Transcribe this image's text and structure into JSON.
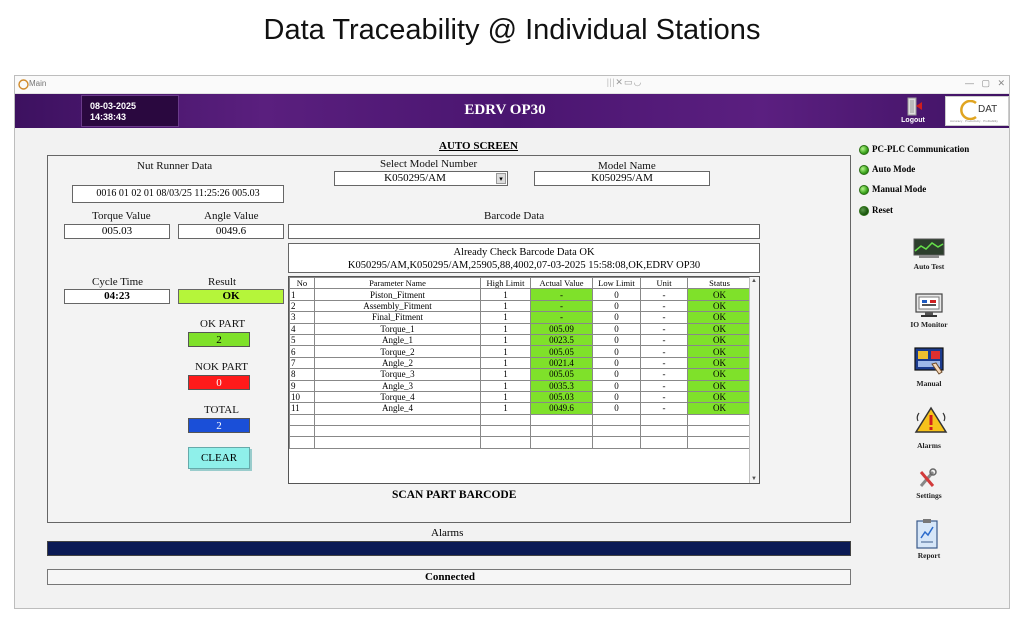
{
  "slide_title": "Data Traceability @ Individual Stations",
  "window": {
    "caption": "Main"
  },
  "header": {
    "date": "08-03-2025",
    "time": "14:38:43",
    "station_title": "EDRV OP30",
    "logout_label": "Logout",
    "logo_text": "DAT",
    "logo_tagline": "Accuracy · Productivity · Profitability"
  },
  "screen_label": "AUTO SCREEN",
  "nut_runner": {
    "label": "Nut Runner Data",
    "value": "0016 01 02 01 08/03/25 11:25:26  005.03"
  },
  "model_select": {
    "label": "Select Model Number",
    "value": "K050295/AM"
  },
  "model_name": {
    "label": "Model Name",
    "value": "K050295/AM"
  },
  "torque": {
    "label": "Torque Value",
    "value": "005.03"
  },
  "angle": {
    "label": "Angle Value",
    "value": "0049.6"
  },
  "barcode": {
    "label": "Barcode Data",
    "value": "",
    "message_line1": "Already Check Barcode Data OK",
    "message_line2": "K050295/AM,K050295/AM,25905,88,4002,07-03-2025 15:58:08,OK,EDRV OP30"
  },
  "cycle_time": {
    "label": "Cycle Time",
    "value": "04:23"
  },
  "result": {
    "label": "Result",
    "value": "OK"
  },
  "ok_part": {
    "label": "OK PART",
    "value": "2"
  },
  "nok_part": {
    "label": "NOK PART",
    "value": "0"
  },
  "total": {
    "label": "TOTAL",
    "value": "2"
  },
  "clear_label": "CLEAR",
  "scan_label": "SCAN PART BARCODE",
  "grid": {
    "headers": [
      "No",
      "Parameter Name",
      "High Limit",
      "Actual Value",
      "Low Limit",
      "Unit",
      "Status"
    ],
    "rows": [
      [
        "1",
        "Piston_Fitment",
        "1",
        "-",
        "0",
        "-",
        "OK"
      ],
      [
        "2",
        "Assembly_Fitment",
        "1",
        "-",
        "0",
        "-",
        "OK"
      ],
      [
        "3",
        "Final_Fitment",
        "1",
        "-",
        "0",
        "-",
        "OK"
      ],
      [
        "4",
        "Torque_1",
        "1",
        "005.09",
        "0",
        "-",
        "OK"
      ],
      [
        "5",
        "Angle_1",
        "1",
        "0023.5",
        "0",
        "-",
        "OK"
      ],
      [
        "6",
        "Torque_2",
        "1",
        "005.05",
        "0",
        "-",
        "OK"
      ],
      [
        "7",
        "Angle_2",
        "1",
        "0021.4",
        "0",
        "-",
        "OK"
      ],
      [
        "8",
        "Torque_3",
        "1",
        "005.05",
        "0",
        "-",
        "OK"
      ],
      [
        "9",
        "Angle_3",
        "1",
        "0035.3",
        "0",
        "-",
        "OK"
      ],
      [
        "10",
        "Torque_4",
        "1",
        "005.03",
        "0",
        "-",
        "OK"
      ],
      [
        "11",
        "Angle_4",
        "1",
        "0049.6",
        "0",
        "-",
        "OK"
      ]
    ],
    "empty_rows": 3
  },
  "alarms_label": "Alarms",
  "status_text": "Connected",
  "indicators": [
    {
      "label": "PC-PLC Communication",
      "state": "on"
    },
    {
      "label": "Auto Mode",
      "state": "on"
    },
    {
      "label": "Manual Mode",
      "state": "on"
    },
    {
      "label": "Reset",
      "state": "off"
    }
  ],
  "side_buttons": [
    {
      "label": "Auto Test",
      "icon": "auto-test-icon"
    },
    {
      "label": "IO Monitor",
      "icon": "io-monitor-icon"
    },
    {
      "label": "Manual",
      "icon": "manual-icon"
    },
    {
      "label": "Alarms",
      "icon": "alarm-icon"
    },
    {
      "label": "Settings",
      "icon": "settings-icon"
    },
    {
      "label": "Report",
      "icon": "report-icon"
    }
  ],
  "colors": {
    "header_purple": "#4a1570",
    "ok_green": "#7fe12a",
    "result_green": "#b5f53a",
    "nok_red": "#ff1a1a",
    "total_blue": "#1a4fd8",
    "alarm_bar": "#0b1a55",
    "clear_cyan": "#8ff0ea"
  }
}
